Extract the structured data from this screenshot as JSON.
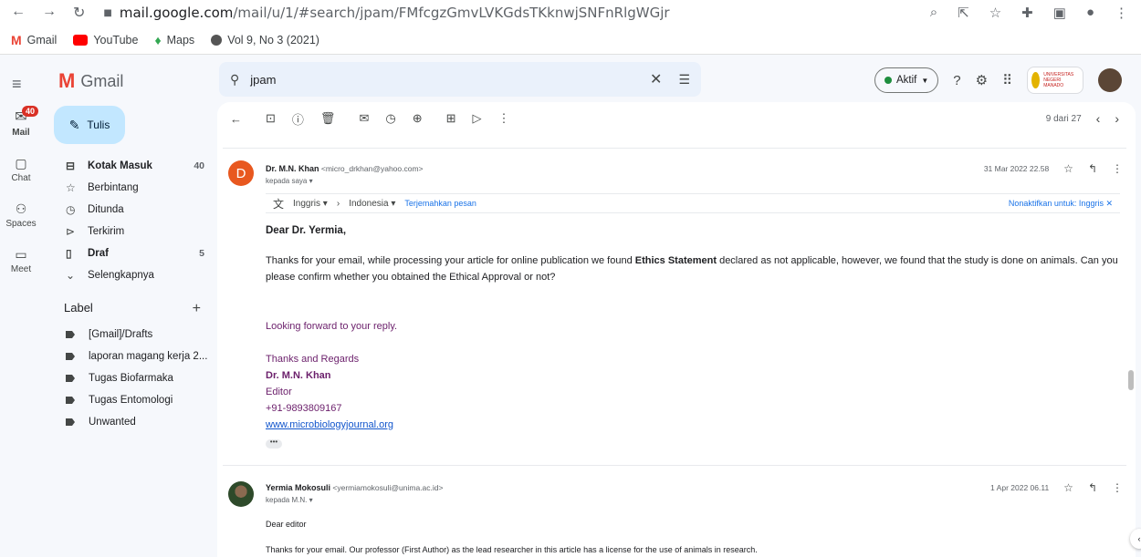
{
  "browser": {
    "url_host": "mail.google.com",
    "url_path": "/mail/u/1/#search/jpam/FMfcgzGmvLVKGdsTKknwjSNFnRlgWGjr",
    "bookmarks": [
      "Gmail",
      "YouTube",
      "Maps",
      "Vol 9, No 3 (2021)"
    ]
  },
  "rail": {
    "mail_label": "Mail",
    "mail_badge": "40",
    "chat_label": "Chat",
    "spaces_label": "Spaces",
    "meet_label": "Meet"
  },
  "app": {
    "name": "Gmail"
  },
  "compose": {
    "label": "Tulis"
  },
  "nav": [
    {
      "label": "Kotak Masuk",
      "count": "40",
      "bold": true,
      "icon": "inbox-icon"
    },
    {
      "label": "Berbintang",
      "count": "",
      "icon": "star-icon"
    },
    {
      "label": "Ditunda",
      "count": "",
      "icon": "clock-icon"
    },
    {
      "label": "Terkirim",
      "count": "",
      "icon": "send-icon"
    },
    {
      "label": "Draf",
      "count": "5",
      "bold": true,
      "icon": "draft-icon"
    },
    {
      "label": "Selengkapnya",
      "count": "",
      "icon": "chevron-down-icon"
    }
  ],
  "labels": {
    "heading": "Label",
    "items": [
      "[Gmail]/Drafts",
      "laporan magang kerja 2...",
      "Tugas Biofarmaka",
      "Tugas Entomologi",
      "Unwanted"
    ]
  },
  "search": {
    "query": "jpam"
  },
  "status": {
    "label": "Aktif"
  },
  "university_text": "UNIVERSITAS NEGERI MANADO",
  "toolbar": {
    "pager": "9 dari 27"
  },
  "message1": {
    "avatar_letter": "D",
    "sender_name": "Dr. M.N. Khan",
    "sender_email": "<micro_drkhan@yahoo.com>",
    "to": "kepada saya",
    "date": "31 Mar 2022 22.58",
    "translate": {
      "from": "Inggris",
      "to": "Indonesia",
      "action": "Terjemahkan pesan",
      "disable": "Nonaktifkan untuk: Inggris"
    },
    "greeting": "Dear Dr. Yermia,",
    "para_before": "Thanks for your email, while processing your article for online publication we found ",
    "para_bold": "Ethics Statement",
    "para_after": " declared as not applicable, however, we found that the study is done on animals. Can you please confirm whether you obtained the Ethical Approval or not?",
    "looking": "Looking forward to your reply.",
    "regards": "Thanks and Regards",
    "sig_name": "Dr. M.N. Khan",
    "sig_title": "Editor",
    "sig_phone": "+91-9893809167",
    "sig_link": "www.microbiologyjournal.org"
  },
  "message2": {
    "sender_name": "Yermia Mokosuli",
    "sender_email": "<yermiamokosuli@unima.ac.id>",
    "to": "kepada M.N.",
    "date": "1 Apr 2022 06.11",
    "line1": "Dear editor",
    "line2": "Thanks for your email. Our professor (First Author) as the lead researcher in this article has a license for the use of animals in research."
  }
}
